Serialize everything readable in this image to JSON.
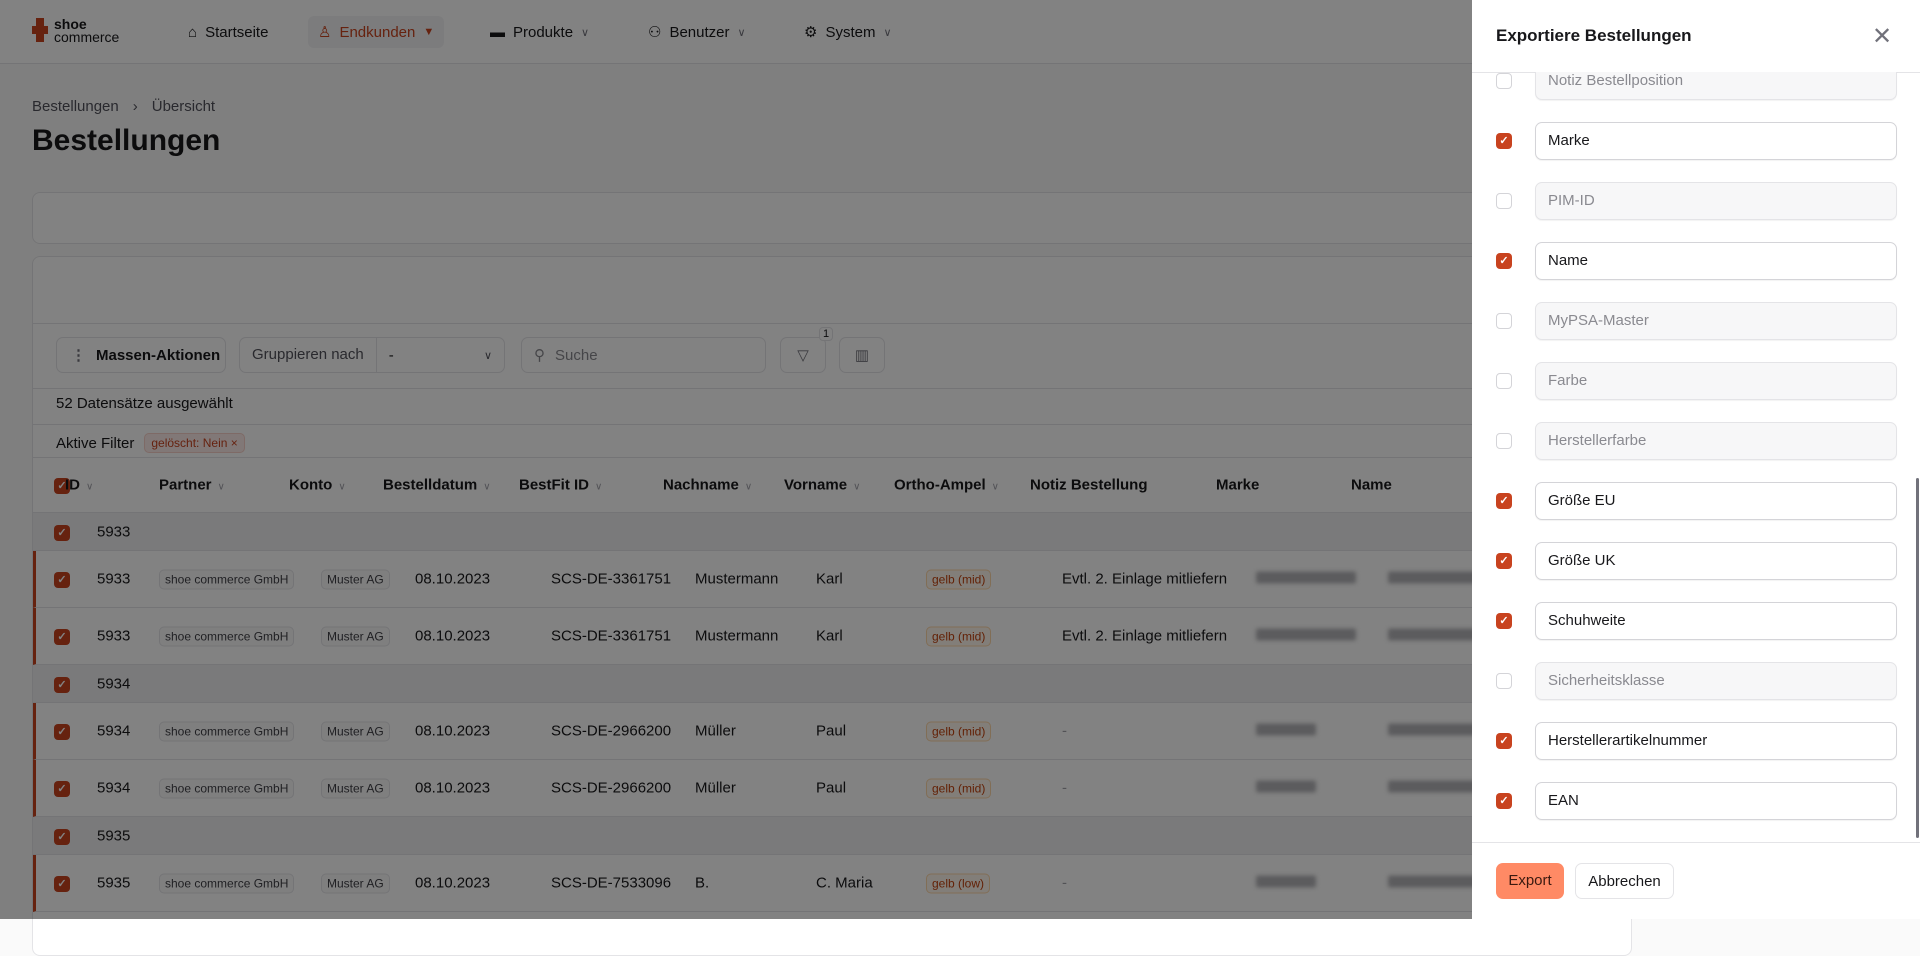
{
  "app": {
    "logo_line1": "shoe",
    "logo_line2": "commerce",
    "brand_color": "#c8431f"
  },
  "nav": [
    {
      "label": "Startseite",
      "icon": "home-icon"
    },
    {
      "label": "Endkunden",
      "icon": "user-icon",
      "active": true
    },
    {
      "label": "Produkte",
      "icon": "shoe-icon"
    },
    {
      "label": "Benutzer",
      "icon": "users-icon"
    },
    {
      "label": "System",
      "icon": "gear-icon"
    }
  ],
  "breadcrumb": [
    "Bestellungen",
    "Übersicht"
  ],
  "page_title": "Bestellungen",
  "toolbar": {
    "mass_actions": "Massen-Aktionen",
    "group_by_label": "Gruppieren nach",
    "group_by_value": "-",
    "search_placeholder": "Suche",
    "filter_count": "1"
  },
  "selection_text": "52 Datensätze ausgewählt",
  "active_filters": {
    "label": "Aktive Filter",
    "chips": [
      "gelöscht: Nein"
    ]
  },
  "table": {
    "columns": [
      "ID",
      "Partner",
      "Konto",
      "Bestelldatum",
      "BestFit ID",
      "Nachname",
      "Vorname",
      "Ortho-Ampel",
      "Notiz Bestellung",
      "Marke",
      "Name"
    ],
    "rows": [
      {
        "type": "group",
        "id": "5933"
      },
      {
        "type": "data",
        "id": "5933",
        "partner": "shoe commerce GmbH",
        "konto": "Muster AG",
        "datum": "08.10.2023",
        "bestfit": "SCS-DE-3361751",
        "nachname": "Mustermann",
        "vorname": "Karl",
        "ampel": "gelb (mid)",
        "notiz": "Evtl. 2. Einlage mitliefern"
      },
      {
        "type": "data",
        "id": "5933",
        "partner": "shoe commerce GmbH",
        "konto": "Muster AG",
        "datum": "08.10.2023",
        "bestfit": "SCS-DE-3361751",
        "nachname": "Mustermann",
        "vorname": "Karl",
        "ampel": "gelb (mid)",
        "notiz": "Evtl. 2. Einlage mitliefern"
      },
      {
        "type": "group",
        "id": "5934"
      },
      {
        "type": "data",
        "id": "5934",
        "partner": "shoe commerce GmbH",
        "konto": "Muster AG",
        "datum": "08.10.2023",
        "bestfit": "SCS-DE-2966200",
        "nachname": "Müller",
        "vorname": "Paul",
        "ampel": "gelb (mid)",
        "notiz": "-"
      },
      {
        "type": "data",
        "id": "5934",
        "partner": "shoe commerce GmbH",
        "konto": "Muster AG",
        "datum": "08.10.2023",
        "bestfit": "SCS-DE-2966200",
        "nachname": "Müller",
        "vorname": "Paul",
        "ampel": "gelb (mid)",
        "notiz": "-"
      },
      {
        "type": "group",
        "id": "5935"
      },
      {
        "type": "data",
        "id": "5935",
        "partner": "shoe commerce GmbH",
        "konto": "Muster AG",
        "datum": "08.10.2023",
        "bestfit": "SCS-DE-7533096",
        "nachname": "B.",
        "vorname": "C. Maria",
        "ampel": "gelb (low)",
        "notiz": "-"
      }
    ]
  },
  "drawer": {
    "title": "Exportiere Bestellungen",
    "fields": [
      {
        "label": "Notiz Bestellposition",
        "checked": false
      },
      {
        "label": "Marke",
        "checked": true
      },
      {
        "label": "PIM-ID",
        "checked": false
      },
      {
        "label": "Name",
        "checked": true
      },
      {
        "label": "MyPSA-Master",
        "checked": false
      },
      {
        "label": "Farbe",
        "checked": false
      },
      {
        "label": "Herstellerfarbe",
        "checked": false
      },
      {
        "label": "Größe EU",
        "checked": true
      },
      {
        "label": "Größe UK",
        "checked": true
      },
      {
        "label": "Schuhweite",
        "checked": true
      },
      {
        "label": "Sicherheitsklasse",
        "checked": false
      },
      {
        "label": "Herstellerartikelnummer",
        "checked": true
      },
      {
        "label": "EAN",
        "checked": true
      }
    ],
    "export_label": "Export",
    "cancel_label": "Abbrechen",
    "export_color": "#ff8a65"
  }
}
